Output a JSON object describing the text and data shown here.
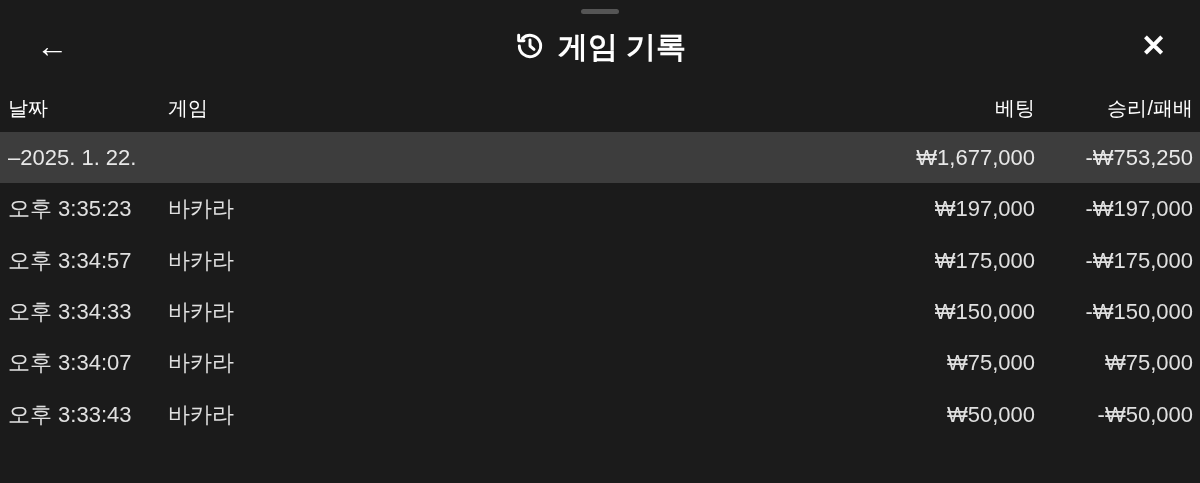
{
  "header": {
    "title": "게임 기록",
    "back": "←",
    "close": "✕"
  },
  "table": {
    "columns": [
      "날짜",
      "게임",
      "베팅",
      "승리/패배"
    ],
    "group": {
      "label": "–2025. 1. 22.",
      "bet": "₩1,677,000",
      "result": "-₩753,250",
      "expanded": true
    },
    "rows": [
      {
        "time": "오후 3:35:23",
        "game": "바카라",
        "bet": "₩197,000",
        "result": "-₩197,000"
      },
      {
        "time": "오후 3:34:57",
        "game": "바카라",
        "bet": "₩175,000",
        "result": "-₩175,000"
      },
      {
        "time": "오후 3:34:33",
        "game": "바카라",
        "bet": "₩150,000",
        "result": "-₩150,000"
      },
      {
        "time": "오후 3:34:07",
        "game": "바카라",
        "bet": "₩75,000",
        "result": "₩75,000"
      },
      {
        "time": "오후 3:33:43",
        "game": "바카라",
        "bet": "₩50,000",
        "result": "-₩50,000"
      }
    ]
  }
}
